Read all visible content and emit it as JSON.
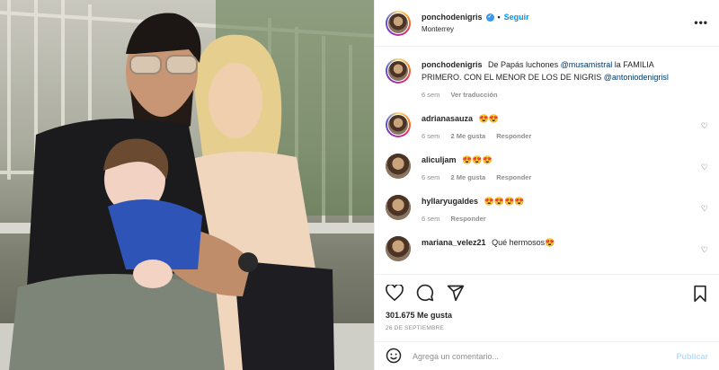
{
  "post": {
    "username": "ponchodenigris",
    "follow_label": "Seguir",
    "separator": "•",
    "location": "Monterrey",
    "more_label": "•••"
  },
  "caption": {
    "username": "ponchodenigris",
    "text_1": "De Papás luchones ",
    "mention_1": "@musamistral",
    "text_2": " la FAMILIA PRIMERO. CON EL MENOR DE LOS DE NIGRIS ",
    "mention_2": "@antoniodenigrisl",
    "time": "6 sem",
    "translate_label": "Ver traducción"
  },
  "comments": [
    {
      "username": "adrianasauza",
      "text": "😍😍",
      "time": "6 sem",
      "likes": "2 Me gusta",
      "reply": "Responder"
    },
    {
      "username": "aliculjam",
      "text": "😍😍😍",
      "time": "6 sem",
      "likes": "2 Me gusta",
      "reply": "Responder"
    },
    {
      "username": "hyllaryugaldes",
      "text": "😍😍😍😍",
      "time": "6 sem",
      "likes": "",
      "reply": "Responder"
    },
    {
      "username": "mariana_velez21",
      "text": "Qué hermosos😍",
      "time": "",
      "likes": "",
      "reply": ""
    }
  ],
  "stats": {
    "likes": "301.675 Me gusta",
    "date": "26 de septiembre"
  },
  "add_comment": {
    "placeholder": "Agrega un comentario...",
    "post_label": "Publicar"
  },
  "icons": {
    "like": "heart-icon",
    "comment": "comment-icon",
    "share": "share-icon",
    "save": "bookmark-icon",
    "emoji": "smiley-icon"
  },
  "colors": {
    "accent": "#0095f6",
    "heart_emoji": "#e0245e",
    "muted": "#8e8e8e"
  }
}
